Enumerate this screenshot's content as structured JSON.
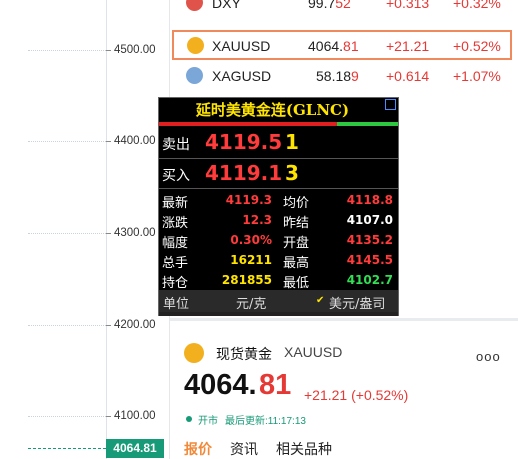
{
  "axis": {
    "labels": [
      "4500.00",
      "4400.00",
      "4300.00",
      "4200.00",
      "4100.00"
    ],
    "current_price_tag": "4064.81"
  },
  "quotes": [
    {
      "name": "DXY",
      "price_main": "99.7",
      "price_tail": "52",
      "change": "+0.313",
      "pct": "+0.32%",
      "icon_color": "#e0534a"
    },
    {
      "name": "XAUUSD",
      "price_main": "4064.",
      "price_tail": "81",
      "change": "+21.21",
      "pct": "+0.52%",
      "icon_color": "#f2b01e"
    },
    {
      "name": "XAGUSD",
      "price_main": "58.18",
      "price_tail": "9",
      "change": "+0.614",
      "pct": "+1.07%",
      "icon_color": "#7aa7d8"
    }
  ],
  "quote_box": {
    "title": "延时美黄金连(GLNC)",
    "sell_label": "卖出",
    "sell_price": "4119.5",
    "sell_vol": "1",
    "buy_label": "买入",
    "buy_price": "4119.1",
    "buy_vol": "3",
    "stats": [
      {
        "l1": "最新",
        "v1": "4119.3",
        "c1": "#ff3b3b",
        "l2": "均价",
        "v2": "4118.8",
        "c2": "#ff3b3b"
      },
      {
        "l1": "涨跌",
        "v1": "12.3",
        "c1": "#ff3b3b",
        "l2": "昨结",
        "v2": "4107.0",
        "c2": "#ffffff"
      },
      {
        "l1": "幅度",
        "v1": "0.30%",
        "c1": "#ff3b3b",
        "l2": "开盘",
        "v2": "4135.2",
        "c2": "#ff3b3b"
      },
      {
        "l1": "总手",
        "v1": "16211",
        "c1": "#ffe400",
        "l2": "最高",
        "v2": "4145.5",
        "c2": "#ff3b3b"
      },
      {
        "l1": "持仓",
        "v1": "281855",
        "c1": "#ffe400",
        "l2": "最低",
        "v2": "4102.7",
        "c2": "#33dd55"
      }
    ],
    "footer_unit_label": "单位",
    "footer_unit_a": "元/克",
    "footer_unit_b": "美元/盎司",
    "footer_check": "✔"
  },
  "detail": {
    "name": "现货黄金",
    "code": "XAUUSD",
    "more": "ooo",
    "price_int": "4064.",
    "price_dec": "81",
    "change": "+21.21 (+0.52%)",
    "status": "开市",
    "updated": "最后更新:11:17:13",
    "tabs": [
      "报价",
      "资讯",
      "相关品种"
    ]
  },
  "colors": {
    "up": "#e53935",
    "accent": "#f08a3a",
    "open": "#179a77"
  }
}
